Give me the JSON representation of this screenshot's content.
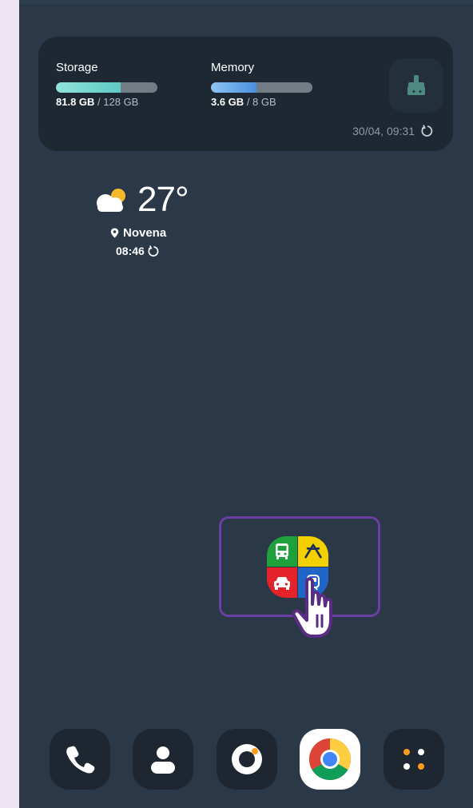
{
  "device_care": {
    "storage": {
      "label": "Storage",
      "used": "81.8 GB",
      "total": "/ 128 GB",
      "fraction": 0.64
    },
    "memory": {
      "label": "Memory",
      "used": "3.6 GB",
      "total": "/ 8 GB",
      "fraction": 0.45
    },
    "updated": "30/04, 09:31",
    "clean_icon": "broom-icon",
    "refresh_icon": "refresh-icon"
  },
  "weather": {
    "temperature": "27°",
    "location": "Novena",
    "time": "08:46",
    "condition_icon": "partly-cloudy-icon"
  },
  "highlighted_app": {
    "icon": "transport-app-icon",
    "quadrants": [
      "bus",
      "taxi-sign",
      "car",
      "train"
    ],
    "colors": [
      "#1ea13a",
      "#f3d000",
      "#e3222a",
      "#2065c8"
    ],
    "highlight_color": "#6a3fa1"
  },
  "dock": {
    "items": [
      "phone-icon",
      "contacts-icon",
      "camera-icon",
      "chrome-icon",
      "app-drawer-icon"
    ]
  },
  "colors": {
    "background": "#2a3848",
    "card": "#1d2833",
    "storage_bar": "#5fc9c4",
    "memory_bar": "#4a8fde"
  }
}
